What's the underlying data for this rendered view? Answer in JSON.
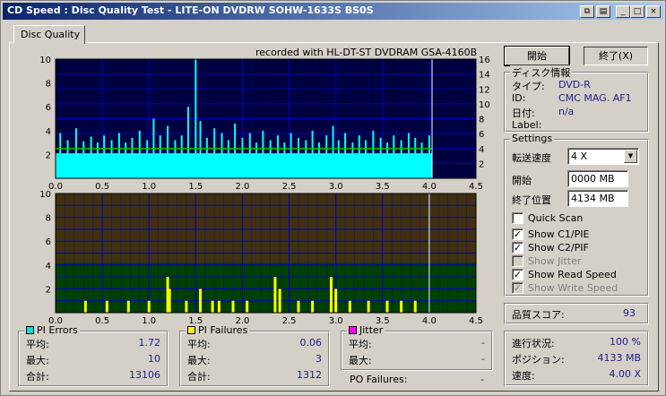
{
  "window": {
    "title": "CD Speed : Disc Quality Test - LITE-ON DVDRW SOHW-1633S BS0S",
    "title_buttons": [
      "⧉",
      "▤",
      "_",
      "□",
      "×"
    ]
  },
  "tabs": [
    {
      "label": "Disc Quality",
      "active": true
    }
  ],
  "recorded_with": "recorded with HL-DT-ST DVDRAM GSA-4160B",
  "chart_data": [
    {
      "type": "bar",
      "name": "pi-errors-chart",
      "x_ticks": [
        "0.0",
        "0.5",
        "1.0",
        "1.5",
        "2.0",
        "2.5",
        "3.0",
        "3.5",
        "4.0",
        "4.5"
      ],
      "y_left_ticks": [
        "2",
        "4",
        "6",
        "8",
        "10"
      ],
      "y_right_ticks": [
        "2",
        "4",
        "6",
        "8",
        "10",
        "12",
        "14",
        "16"
      ],
      "xlim": [
        0,
        4.5
      ],
      "ylim_left": [
        0,
        10
      ],
      "ylim_right": [
        0,
        16
      ],
      "data_end_x": 4.03,
      "pi_baseline": 2.1,
      "pi_spikes": [
        [
          0.05,
          3.8
        ],
        [
          0.13,
          3.2
        ],
        [
          0.22,
          4.2
        ],
        [
          0.3,
          3.1
        ],
        [
          0.38,
          3.5
        ],
        [
          0.45,
          3.0
        ],
        [
          0.52,
          3.6
        ],
        [
          0.6,
          3.2
        ],
        [
          0.68,
          3.8
        ],
        [
          0.75,
          3.0
        ],
        [
          0.82,
          3.4
        ],
        [
          0.9,
          4.0
        ],
        [
          0.98,
          3.2
        ],
        [
          1.05,
          5.0
        ],
        [
          1.12,
          3.6
        ],
        [
          1.2,
          4.4
        ],
        [
          1.28,
          3.2
        ],
        [
          1.35,
          3.6
        ],
        [
          1.42,
          6.0
        ],
        [
          1.5,
          10.0
        ],
        [
          1.55,
          4.8
        ],
        [
          1.62,
          3.4
        ],
        [
          1.7,
          4.2
        ],
        [
          1.78,
          3.8
        ],
        [
          1.85,
          3.2
        ],
        [
          1.92,
          4.6
        ],
        [
          2.0,
          3.4
        ],
        [
          2.08,
          3.8
        ],
        [
          2.15,
          3.0
        ],
        [
          2.22,
          4.0
        ],
        [
          2.3,
          3.2
        ],
        [
          2.38,
          3.6
        ],
        [
          2.45,
          3.0
        ],
        [
          2.52,
          3.8
        ],
        [
          2.6,
          3.4
        ],
        [
          2.68,
          3.2
        ],
        [
          2.75,
          4.0
        ],
        [
          2.82,
          3.0
        ],
        [
          2.9,
          3.6
        ],
        [
          2.97,
          4.4
        ],
        [
          3.03,
          3.2
        ],
        [
          3.1,
          3.8
        ],
        [
          3.18,
          3.0
        ],
        [
          3.25,
          3.6
        ],
        [
          3.32,
          3.2
        ],
        [
          3.4,
          4.0
        ],
        [
          3.48,
          3.4
        ],
        [
          3.55,
          3.0
        ],
        [
          3.62,
          3.6
        ],
        [
          3.7,
          3.2
        ],
        [
          3.78,
          3.8
        ],
        [
          3.85,
          3.4
        ],
        [
          3.92,
          3.0
        ],
        [
          4.0,
          3.6
        ]
      ],
      "read_speed_x": 4.0,
      "colors": {
        "plot_bg": "#000040",
        "pi": "#00ffff",
        "pi_max": "#0000ff",
        "grid": "#0000c0",
        "speed": "#00c000"
      }
    },
    {
      "type": "bar",
      "name": "pi-failures-chart",
      "x_ticks": [
        "0.0",
        "0.5",
        "1.0",
        "1.5",
        "2.0",
        "2.5",
        "3.0",
        "3.5",
        "4.0",
        "4.5"
      ],
      "y_left_ticks": [
        "2",
        "4",
        "6",
        "8",
        "10"
      ],
      "xlim": [
        0,
        4.5
      ],
      "ylim": [
        0,
        10
      ],
      "green_band_top": 4.2,
      "end_marker_x": 4.0,
      "pif_spikes": [
        [
          0.32,
          1.0
        ],
        [
          0.55,
          1.0
        ],
        [
          0.78,
          1.0
        ],
        [
          1.0,
          1.0
        ],
        [
          1.2,
          3.0
        ],
        [
          1.22,
          2.0
        ],
        [
          1.4,
          1.0
        ],
        [
          1.55,
          2.0
        ],
        [
          1.68,
          1.0
        ],
        [
          1.75,
          1.0
        ],
        [
          1.9,
          1.0
        ],
        [
          2.05,
          1.0
        ],
        [
          2.35,
          3.0
        ],
        [
          2.4,
          2.0
        ],
        [
          2.6,
          1.0
        ],
        [
          2.75,
          1.0
        ],
        [
          2.95,
          3.0
        ],
        [
          3.0,
          2.0
        ],
        [
          3.15,
          1.0
        ],
        [
          3.35,
          1.0
        ],
        [
          3.55,
          1.0
        ],
        [
          3.7,
          1.0
        ],
        [
          3.85,
          1.0
        ]
      ],
      "colors": {
        "upper_bg": "#403010",
        "lower_bg": "#004000",
        "grid": "#0000c0",
        "pif": "#ffff00"
      }
    }
  ],
  "pi_errors": {
    "label": "PI Errors",
    "color": "#00e0e0",
    "rows": [
      {
        "k": "平均:",
        "v": "1.72"
      },
      {
        "k": "最大:",
        "v": "10"
      },
      {
        "k": "合計:",
        "v": "13106"
      }
    ]
  },
  "pi_failures": {
    "label": "PI Failures",
    "color": "#ffff00",
    "rows": [
      {
        "k": "平均:",
        "v": "0.06"
      },
      {
        "k": "最大:",
        "v": "3"
      },
      {
        "k": "合計:",
        "v": "1312"
      }
    ]
  },
  "jitter": {
    "label": "Jitter",
    "color": "#ff00ff",
    "rows": [
      {
        "k": "平均:",
        "v": "-"
      },
      {
        "k": "最大:",
        "v": "-"
      }
    ]
  },
  "po_failures": {
    "label": "PO Failures:",
    "value": "-"
  },
  "buttons": {
    "start": "開始",
    "stop": "終了(X)"
  },
  "disc_info": {
    "label": "ディスク情報",
    "rows": [
      {
        "k": "タイプ:",
        "v": "DVD-R"
      },
      {
        "k": "ID:",
        "v": "CMC MAG. AF1"
      },
      {
        "k": "日付:",
        "v": "n/a"
      },
      {
        "k": "Label:",
        "v": ""
      }
    ]
  },
  "settings": {
    "label": "Settings",
    "speed_label": "転送速度",
    "speed_value": "4 X",
    "start_label": "開始",
    "start_value": "0000 MB",
    "end_label": "終了位置",
    "end_value": "4134 MB",
    "checkboxes": [
      {
        "label": "Quick Scan",
        "checked": false,
        "enabled": true
      },
      {
        "label": "Show C1/PIE",
        "checked": true,
        "enabled": true
      },
      {
        "label": "Show C2/PIF",
        "checked": true,
        "enabled": true
      },
      {
        "label": "Show Jitter",
        "checked": false,
        "enabled": false
      },
      {
        "label": "Show Read Speed",
        "checked": true,
        "enabled": true
      },
      {
        "label": "Show Write Speed",
        "checked": true,
        "enabled": false
      }
    ]
  },
  "quality_score": {
    "label": "品質スコア:",
    "value": "93"
  },
  "progress": {
    "rows": [
      {
        "k": "進行状況:",
        "v": "100 %"
      },
      {
        "k": "ポジション:",
        "v": "4133 MB"
      },
      {
        "k": "速度:",
        "v": "4.00 X"
      }
    ]
  }
}
